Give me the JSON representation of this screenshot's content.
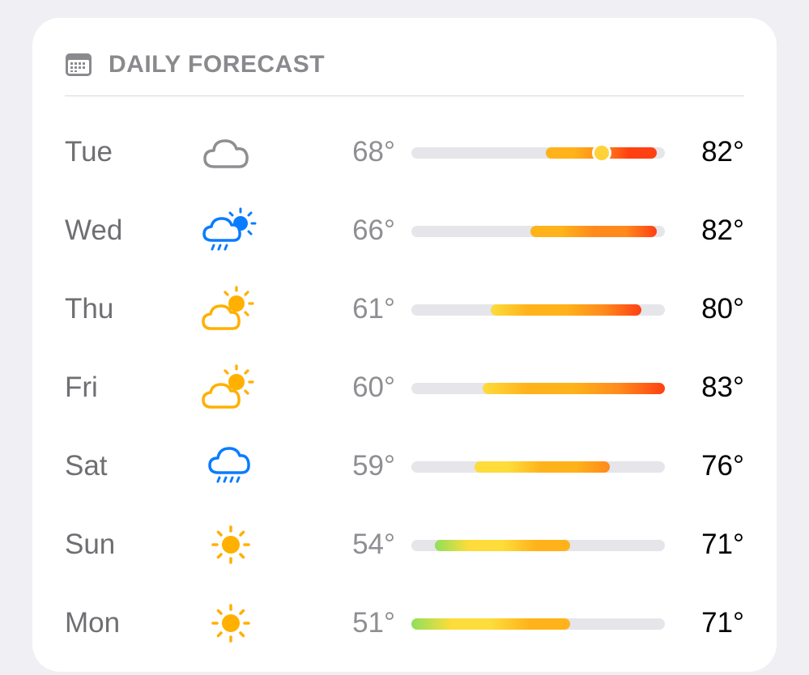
{
  "header": {
    "title": "DAILY FORECAST",
    "icon": "calendar-icon"
  },
  "scale": {
    "min": 51,
    "max": 83,
    "current_temp_tue": 75
  },
  "colors": {
    "green": "#8fe05a",
    "yellow": "#fddc3b",
    "amber": "#ffb21a",
    "orange": "#ff8a1c",
    "red": "#ff4013",
    "track": "#e5e5ea",
    "sun": "#ffb000",
    "rain_blue": "#0a7cff",
    "cloud_gray": "#8e8e93"
  },
  "days": [
    {
      "day": "Tue",
      "icon": "cloud-icon",
      "low": "68°",
      "high": "82°",
      "low_val": 68,
      "high_val": 82
    },
    {
      "day": "Wed",
      "icon": "cloud-sun-rain-icon",
      "low": "66°",
      "high": "82°",
      "low_val": 66,
      "high_val": 82
    },
    {
      "day": "Thu",
      "icon": "cloud-sun-icon",
      "low": "61°",
      "high": "80°",
      "low_val": 61,
      "high_val": 80
    },
    {
      "day": "Fri",
      "icon": "cloud-sun-icon",
      "low": "60°",
      "high": "83°",
      "low_val": 60,
      "high_val": 83
    },
    {
      "day": "Sat",
      "icon": "cloud-rain-icon",
      "low": "59°",
      "high": "76°",
      "low_val": 59,
      "high_val": 76
    },
    {
      "day": "Sun",
      "icon": "sun-icon",
      "low": "54°",
      "high": "71°",
      "low_val": 54,
      "high_val": 71
    },
    {
      "day": "Mon",
      "icon": "sun-icon",
      "low": "51°",
      "high": "71°",
      "low_val": 51,
      "high_val": 71
    }
  ]
}
